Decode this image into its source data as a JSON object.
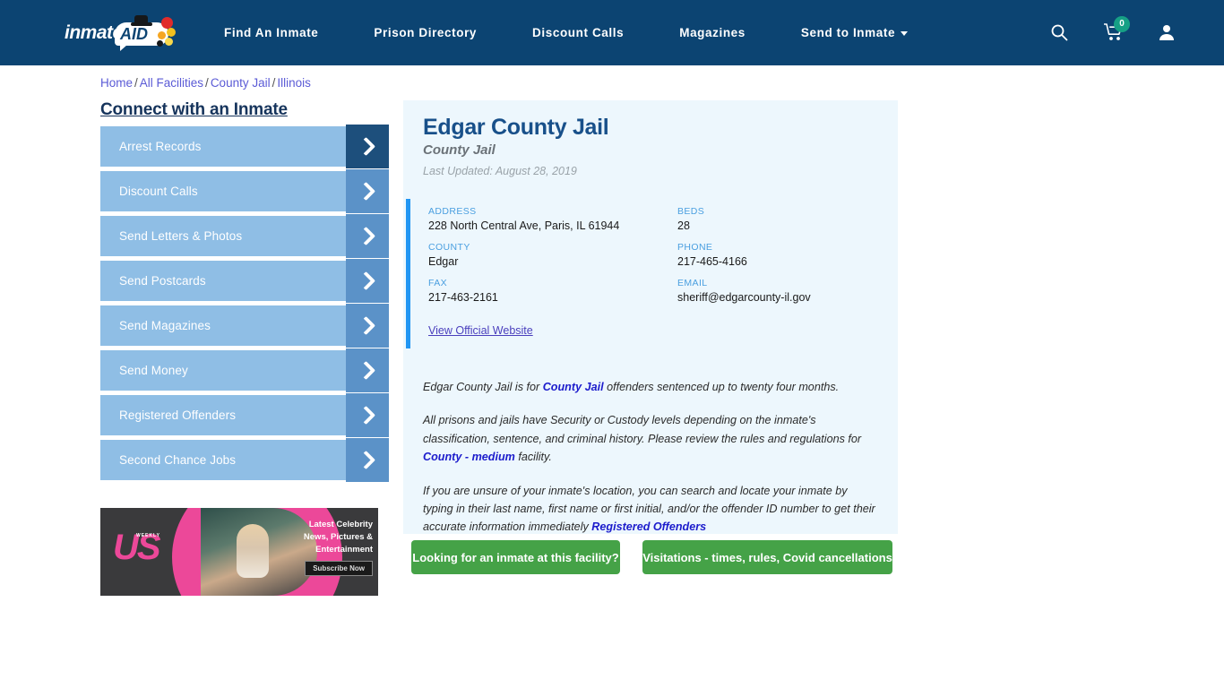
{
  "header": {
    "logo": {
      "text": "inmate",
      "badge": "AID",
      "name": "inmateaid-logo"
    },
    "nav": [
      {
        "label": "Find An Inmate",
        "name": "nav-find-an-inmate"
      },
      {
        "label": "Prison Directory",
        "name": "nav-prison-directory"
      },
      {
        "label": "Discount Calls",
        "name": "nav-discount-calls"
      },
      {
        "label": "Magazines",
        "name": "nav-magazines"
      },
      {
        "label": "Send to Inmate",
        "name": "nav-send-to-inmate",
        "has_caret": true
      }
    ],
    "icons": {
      "search": "search-icon",
      "cart": "cart-icon",
      "cart_count": "0",
      "account": "user-account-icon"
    },
    "background_color": "#0c4472"
  },
  "breadcrumb": {
    "items": [
      "Home",
      "All Facilities",
      "County Jail",
      "Illinois"
    ],
    "separator": "/"
  },
  "sidebar": {
    "title": "Connect with an Inmate",
    "items": [
      {
        "label": "Arrest Records"
      },
      {
        "label": "Discount Calls"
      },
      {
        "label": "Send Letters & Photos"
      },
      {
        "label": "Send Postcards"
      },
      {
        "label": "Send Magazines"
      },
      {
        "label": "Send Money"
      },
      {
        "label": "Registered Offenders"
      },
      {
        "label": "Second Chance Jobs"
      }
    ],
    "button_color": "#8fbee5",
    "arrow_color": "#5b92c8",
    "arrow_color_active": "#1d4f7c"
  },
  "ad": {
    "brand": "US",
    "brand_sub": "WEEKLY",
    "line1": "Latest Celebrity",
    "line2": "News, Pictures &",
    "line3": "Entertainment",
    "cta": "Subscribe Now"
  },
  "facility": {
    "name": "Edgar County Jail",
    "type": "County Jail",
    "last_updated": "Last Updated: August 28, 2019",
    "details": [
      {
        "key": "ADDRESS",
        "value": "228 North Central Ave, Paris, IL 61944"
      },
      {
        "key": "BEDS",
        "value": "28"
      },
      {
        "key": "COUNTY",
        "value": "Edgar"
      },
      {
        "key": "PHONE",
        "value": "217-465-4166"
      },
      {
        "key": "FAX",
        "value": "217-463-2161"
      },
      {
        "key": "EMAIL",
        "value": "sheriff@edgarcounty-il.gov"
      }
    ],
    "official_website_link": "View Official Website",
    "accent_color": "#2196f3",
    "panel_background": "#edf7fd"
  },
  "description": {
    "p1_a": "Edgar County Jail is for ",
    "p1_link": "County Jail",
    "p1_b": " offenders sentenced up to twenty four months.",
    "p2_a": "All prisons and jails have Security or Custody levels depending on the inmate's classification, sentence, and criminal history. Please review the rules and regulations for ",
    "p2_link": "County - medium",
    "p2_b": " facility.",
    "p3_a": "If you are unsure of your inmate's location, you can search and locate your inmate by typing in their last name, first name or first initial, and/or the offender ID number to get their accurate information immediately ",
    "p3_link": "Registered Offenders",
    "p3_b": ""
  },
  "actions": {
    "find_inmate": "Looking for an inmate at this facility?",
    "visitations": "Visitations - times, rules, Covid cancellations",
    "color": "#45a247"
  }
}
